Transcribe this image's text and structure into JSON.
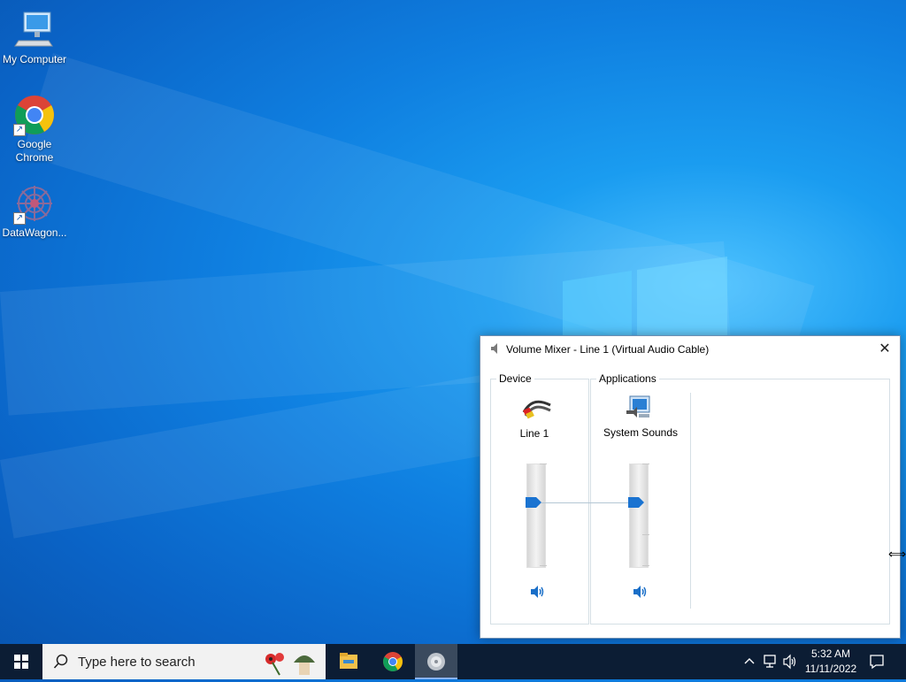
{
  "desktop": {
    "icons": [
      {
        "label": "My Computer",
        "icon": "computer-icon"
      },
      {
        "label": "Google Chrome",
        "icon": "chrome-icon"
      },
      {
        "label": "DataWagon...",
        "icon": "datawagon-icon"
      }
    ]
  },
  "volume_mixer": {
    "title": "Volume Mixer - Line 1 (Virtual Audio Cable)",
    "close_label": "✕",
    "device_group_label": "Device",
    "applications_group_label": "Applications",
    "channels": [
      {
        "name": "Line 1",
        "icon": "audio-cable-icon",
        "volume_fraction": 0.62
      },
      {
        "name": "System Sounds",
        "icon": "system-sounds-icon",
        "volume_fraction": 0.62
      }
    ]
  },
  "taskbar": {
    "search_placeholder": "Type here to search",
    "pinned": [
      {
        "icon": "file-explorer-icon"
      },
      {
        "icon": "chrome-icon"
      },
      {
        "icon": "volume-mixer-app-icon",
        "active": true
      }
    ],
    "tray": {
      "time": "5:32 AM",
      "date": "11/11/2022"
    }
  },
  "colors": {
    "accent": "#0078d7",
    "taskbar": "#0c1d34",
    "desktop": "#0f7fe0"
  }
}
